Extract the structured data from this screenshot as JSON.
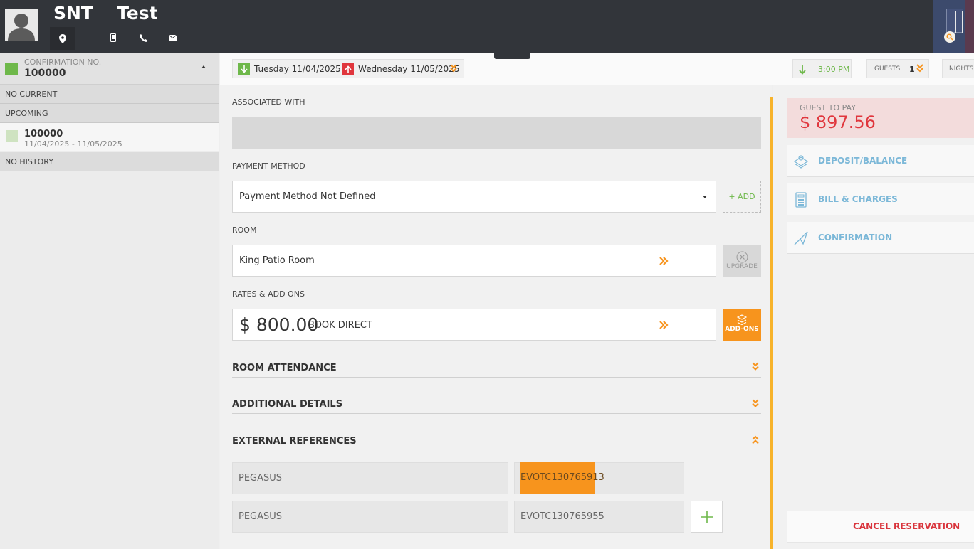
{
  "header": {
    "first_name": "SNT",
    "last_name": "Test",
    "icons": [
      "location-icon",
      "mobile-icon",
      "phone-icon",
      "mail-icon"
    ]
  },
  "reservation": {
    "confirmation_label": "CONFIRMATION NO.",
    "confirmation_no": "100000"
  },
  "left_panel": {
    "no_current": "NO CURRENT",
    "upcoming": "UPCOMING",
    "upcoming_item": {
      "number": "100000",
      "dates": "11/04/2025 - 11/05/2025"
    },
    "no_history": "NO HISTORY"
  },
  "datebar": {
    "arrival": "Tuesday 11/04/2025",
    "departure": "Wednesday 11/05/2025",
    "arrival_time": "3:00 PM",
    "guests_label": "GUESTS",
    "guests_count": "1",
    "nights_label": "NIGHTS"
  },
  "form": {
    "associated_with_label": "ASSOCIATED WITH",
    "payment_method_label": "PAYMENT METHOD",
    "payment_method_value": "Payment Method Not Defined",
    "add_label": "+ ADD",
    "room_label": "ROOM",
    "room_value": "King Patio Room",
    "upgrade_label": "UPGRADE",
    "rates_label": "RATES & ADD ONS",
    "rate_amount": "$ 800.00",
    "rate_name": "BOOK DIRECT",
    "addons_label": "ADD-ONS",
    "room_attendance": "ROOM ATTENDANCE",
    "additional_details": "ADDITIONAL DETAILS",
    "external_references": "EXTERNAL REFERENCES",
    "ext_refs": [
      {
        "source": "PEGASUS",
        "code": "EVOTC130765913"
      },
      {
        "source": "PEGASUS",
        "code": "EVOTC130765955"
      }
    ]
  },
  "right_panel": {
    "guest_to_pay_label": "GUEST TO PAY",
    "guest_to_pay_amount": "$ 897.56",
    "deposit_balance": "DEPOSIT/BALANCE",
    "bill_charges": "BILL & CHARGES",
    "confirmation": "CONFIRMATION",
    "cancel_reservation": "CANCEL RESERVATION"
  },
  "colors": {
    "header_bg": "#32353a",
    "accent_orange": "#f7941d",
    "accent_green": "#6eb84a",
    "accent_red": "#e0363d",
    "link_blue": "#7cb8d8"
  }
}
